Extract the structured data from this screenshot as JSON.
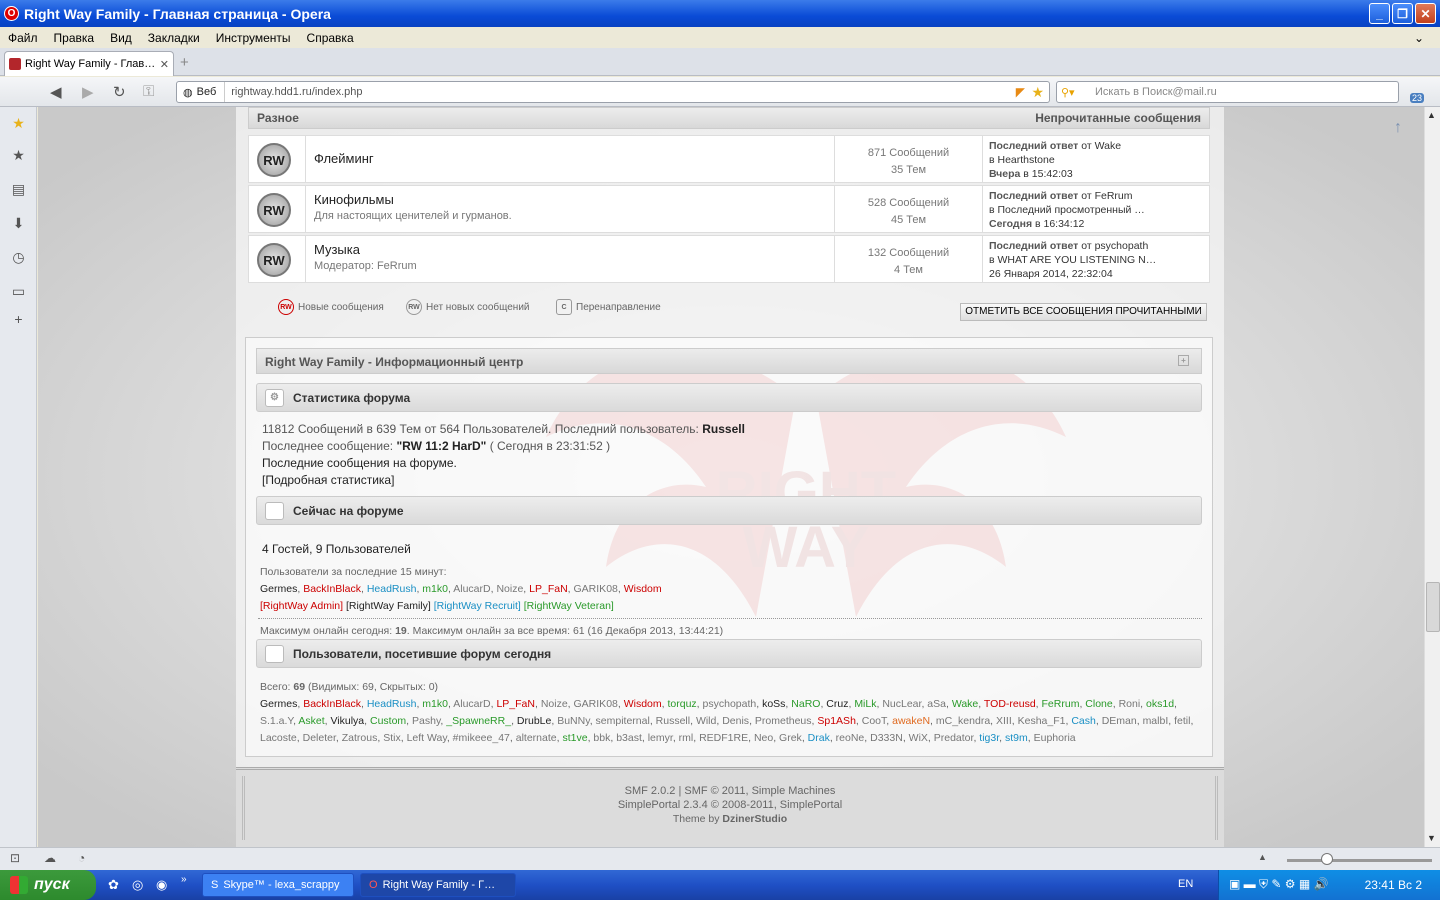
{
  "window": {
    "title": "Right Way Family - Главная страница - Opera"
  },
  "menu": [
    "Файл",
    "Правка",
    "Вид",
    "Закладки",
    "Инструменты",
    "Справка"
  ],
  "tab": {
    "title": "Right Way Family - Глав…"
  },
  "address": {
    "badge": "Веб",
    "url": "rightway.hdd1.ru/index.php"
  },
  "search": {
    "placeholder": "Искать в Поиск@mail.ru"
  },
  "mail_count": "23",
  "category": {
    "name": "Разное",
    "unread_link": "Непрочитанные сообщения"
  },
  "boards": [
    {
      "icon": "RW",
      "name": "Флейминг",
      "desc": "",
      "posts": "871 Сообщений",
      "topics": "35 Тем",
      "last_label": "Последний ответ",
      "last_by": "от Wake",
      "last_in": "в Hearthstone",
      "last_when_b": "Вчера",
      "last_when": "в 15:42:03"
    },
    {
      "icon": "RW",
      "name": "Кинофильмы",
      "desc": "Для настоящих ценителей и гурманов.",
      "posts": "528 Сообщений",
      "topics": "45 Тем",
      "last_label": "Последний ответ",
      "last_by": "от FeRrum",
      "last_in": "в Последний просмотренный …",
      "last_when_b": "Сегодня",
      "last_when": "в 16:34:12"
    },
    {
      "icon": "RW",
      "name": "Музыка",
      "desc": "Модератор: FeRrum",
      "posts": "132 Сообщений",
      "topics": "4 Тем",
      "last_label": "Последний ответ",
      "last_by": "от psychopath",
      "last_in": "в WHAT ARE YOU LISTENING N…",
      "last_when_b": "",
      "last_when": "26 Января 2014, 22:32:04"
    }
  ],
  "legend": {
    "new": "Новые сообщения",
    "nonew": "Нет новых сообщений",
    "redirect": "Перенаправление",
    "mark_all": "ОТМЕТИТЬ ВСЕ СООБЩЕНИЯ ПРОЧИТАННЫМИ"
  },
  "info": {
    "title": "Right Way Family - Информационный центр",
    "stats_title": "Статистика форума",
    "stats_line1": "11812 Сообщений в 639 Тем от 564 Пользователей. Последний пользователь:",
    "stats_user": "Russell",
    "stats_line2a": "Последнее сообщение:",
    "stats_post": "\"RW 11:2 HarD\"",
    "stats_line2b": "( Сегодня в 23:31:52 )",
    "stats_line3": "Последние сообщения на форуме.",
    "stats_line4": "[Подробная статистика]",
    "online_title": "Сейчас на форуме",
    "online_count": "4 Гостей, 9 Пользователей",
    "online_15": "Пользователи за последние 15 минут:",
    "online_users": [
      {
        "n": "Germes",
        "c": "dark"
      },
      {
        "n": "BackInBlack",
        "c": "red"
      },
      {
        "n": "HeadRush",
        "c": "blue"
      },
      {
        "n": "m1k0",
        "c": "green"
      },
      {
        "n": "AlucarD",
        "c": "gray"
      },
      {
        "n": "Noize",
        "c": "gray"
      },
      {
        "n": "LP_FaN",
        "c": "red"
      },
      {
        "n": "GARIK08",
        "c": "gray"
      },
      {
        "n": "Wisdom",
        "c": "red"
      }
    ],
    "groups": [
      {
        "n": "[RightWay Admin]",
        "c": "red"
      },
      {
        "n": "[RightWay Family]",
        "c": "dark"
      },
      {
        "n": "[RightWay Recruit]",
        "c": "blue"
      },
      {
        "n": "[RightWay Veteran]",
        "c": "green"
      }
    ],
    "max_online_a": "Максимум онлайн сегодня:",
    "max_online_b": "19",
    "max_online_c": ". Максимум онлайн за все время: 61 (16 Декабря 2013, 13:44:21)",
    "today_title": "Пользователи, посетившие форум сегодня",
    "today_total_a": "Всего:",
    "today_total_b": "69",
    "today_total_c": "(Видимых: 69, Скрытых: 0)",
    "today_users": [
      {
        "n": "Germes",
        "c": "dark"
      },
      {
        "n": "BackInBlack",
        "c": "red"
      },
      {
        "n": "HeadRush",
        "c": "blue"
      },
      {
        "n": "m1k0",
        "c": "green"
      },
      {
        "n": "AlucarD",
        "c": "gray"
      },
      {
        "n": "LP_FaN",
        "c": "red"
      },
      {
        "n": "Noize",
        "c": "gray"
      },
      {
        "n": "GARIK08",
        "c": "gray"
      },
      {
        "n": "Wisdom",
        "c": "red"
      },
      {
        "n": "torquz",
        "c": "green"
      },
      {
        "n": "psychopath",
        "c": "gray"
      },
      {
        "n": "koSs",
        "c": "dark"
      },
      {
        "n": "NaRO",
        "c": "green"
      },
      {
        "n": "Cruz",
        "c": "dark"
      },
      {
        "n": "MiLk",
        "c": "green"
      },
      {
        "n": "NucLear",
        "c": "gray"
      },
      {
        "n": "aSa",
        "c": "gray"
      },
      {
        "n": "Wake",
        "c": "green"
      },
      {
        "n": "TOD-reusd",
        "c": "red"
      },
      {
        "n": "FeRrum",
        "c": "green"
      },
      {
        "n": "Clone",
        "c": "green"
      },
      {
        "n": "Roni",
        "c": "gray"
      },
      {
        "n": "oks1d",
        "c": "green"
      },
      {
        "n": "S.1.a.Y",
        "c": "gray"
      },
      {
        "n": "Asket",
        "c": "green"
      },
      {
        "n": "Vikulya",
        "c": "dark"
      },
      {
        "n": "Custom",
        "c": "green"
      },
      {
        "n": "Pashy",
        "c": "gray"
      },
      {
        "n": "_SpawneRR_",
        "c": "green"
      },
      {
        "n": "DrubLe",
        "c": "dark"
      },
      {
        "n": "BuNNy",
        "c": "gray"
      },
      {
        "n": "sempiternal",
        "c": "gray"
      },
      {
        "n": "Russell",
        "c": "gray"
      },
      {
        "n": "Wild",
        "c": "gray"
      },
      {
        "n": "Denis",
        "c": "gray"
      },
      {
        "n": "Prometheus",
        "c": "gray"
      },
      {
        "n": "Sp1ASh",
        "c": "red"
      },
      {
        "n": "CooT",
        "c": "gray"
      },
      {
        "n": "awakeN",
        "c": "orange"
      },
      {
        "n": "mC_kendra",
        "c": "gray"
      },
      {
        "n": "XIII",
        "c": "gray"
      },
      {
        "n": "Kesha_F1",
        "c": "gray"
      },
      {
        "n": "Cash",
        "c": "blue"
      },
      {
        "n": "DEman",
        "c": "gray"
      },
      {
        "n": "malbI",
        "c": "gray"
      },
      {
        "n": "fetil",
        "c": "gray"
      },
      {
        "n": "Lacoste",
        "c": "gray"
      },
      {
        "n": "Deleter",
        "c": "gray"
      },
      {
        "n": "Zatrous",
        "c": "gray"
      },
      {
        "n": "Stix",
        "c": "gray"
      },
      {
        "n": "Left Way",
        "c": "gray"
      },
      {
        "n": "#mikeee_47",
        "c": "gray"
      },
      {
        "n": "alternate",
        "c": "gray"
      },
      {
        "n": "st1ve",
        "c": "green"
      },
      {
        "n": "bbk",
        "c": "gray"
      },
      {
        "n": "b3ast",
        "c": "gray"
      },
      {
        "n": "lemyr",
        "c": "gray"
      },
      {
        "n": "rml",
        "c": "gray"
      },
      {
        "n": "REDF1RE",
        "c": "gray"
      },
      {
        "n": "Neo",
        "c": "gray"
      },
      {
        "n": "Grek",
        "c": "gray"
      },
      {
        "n": "Drak",
        "c": "blue"
      },
      {
        "n": "reoNe",
        "c": "gray"
      },
      {
        "n": "D333N",
        "c": "gray"
      },
      {
        "n": "WiX",
        "c": "gray"
      },
      {
        "n": "Predator",
        "c": "gray"
      },
      {
        "n": "tig3r",
        "c": "blue"
      },
      {
        "n": "st9m",
        "c": "blue"
      },
      {
        "n": "Euphoria",
        "c": "gray"
      }
    ]
  },
  "footer": {
    "line1": "SMF 2.0.2 | SMF © 2011, Simple Machines",
    "line2": "SimplePortal 2.3.4 © 2008-2011, SimplePortal",
    "line3a": "Theme by",
    "line3b": "DzinerStudio"
  },
  "watermark": {
    "line1": "RIGHT",
    "line2": "WAY"
  },
  "taskbar": {
    "start": "пуск",
    "items": [
      "Skype™ - lexa_scrappy",
      "Right Way Family - Г…"
    ],
    "lang": "EN",
    "clock": "23:41 Вс 2"
  },
  "colors": {
    "red": "#cc0000",
    "blue": "#1a8fc4",
    "green": "#2a9a2a",
    "gray": "#777777",
    "dark": "#222222",
    "orange": "#e06a20"
  }
}
